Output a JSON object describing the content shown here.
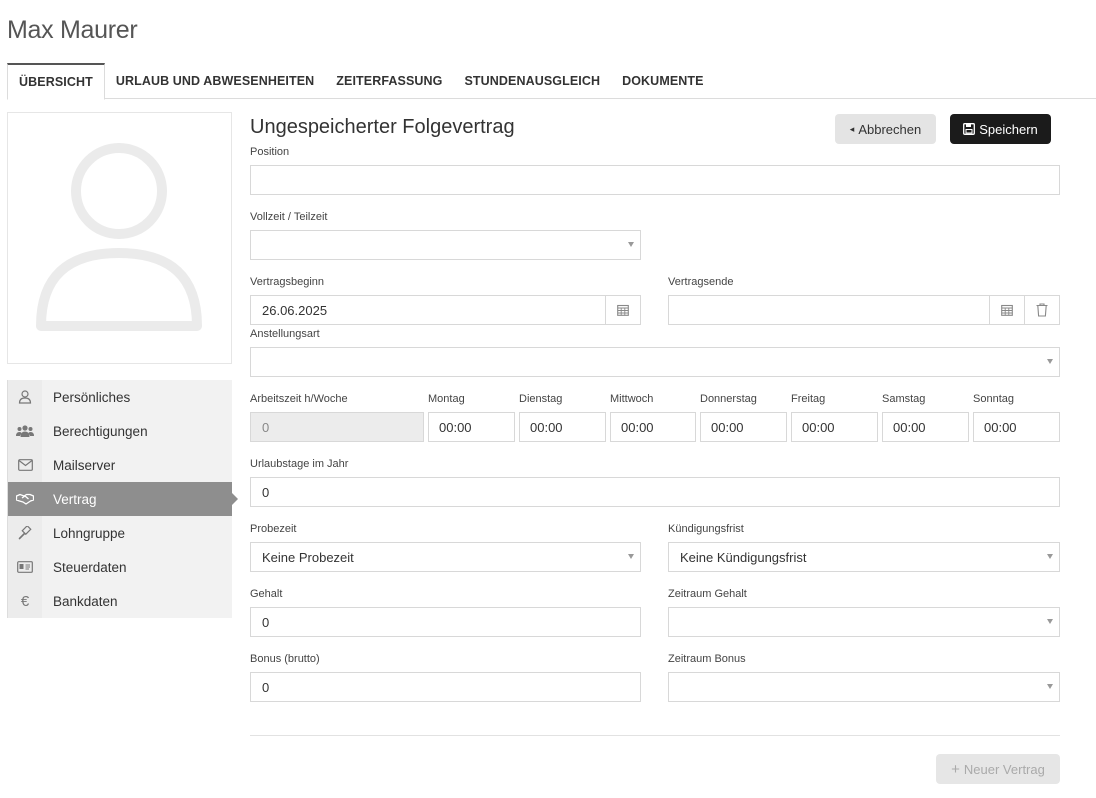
{
  "header": {
    "employee_name": "Max Maurer"
  },
  "tabs": [
    {
      "label": "ÜBERSICHT",
      "active": true
    },
    {
      "label": "URLAUB UND ABWESENHEITEN"
    },
    {
      "label": "ZEITERFASSUNG"
    },
    {
      "label": "STUNDENAUSGLEICH"
    },
    {
      "label": "DOKUMENTE"
    }
  ],
  "sidebar": {
    "items": [
      {
        "label": "Persönliches",
        "icon": "user-icon"
      },
      {
        "label": "Berechtigungen",
        "icon": "users-icon"
      },
      {
        "label": "Mailserver",
        "icon": "envelope-icon"
      },
      {
        "label": "Vertrag",
        "icon": "handshake-icon",
        "active": true
      },
      {
        "label": "Lohngruppe",
        "icon": "gavel-icon"
      },
      {
        "label": "Steuerdaten",
        "icon": "id-card-icon"
      },
      {
        "label": "Bankdaten",
        "icon": "euro-icon"
      }
    ]
  },
  "form": {
    "title": "Ungespeicherter Folgevertrag",
    "cancel_label": "Abbrechen",
    "save_label": "Speichern",
    "position": {
      "label": "Position",
      "value": ""
    },
    "vollzeit": {
      "label": "Vollzeit / Teilzeit",
      "value": ""
    },
    "vertragsbeginn": {
      "label": "Vertragsbeginn",
      "value": "26.06.2025"
    },
    "vertragsende": {
      "label": "Vertragsende",
      "value": ""
    },
    "anstellungsart": {
      "label": "Anstellungsart",
      "value": ""
    },
    "arbeitszeit": {
      "label": "Arbeitszeit h/Woche",
      "value": "0"
    },
    "days": [
      {
        "label": "Montag",
        "value": "00:00"
      },
      {
        "label": "Dienstag",
        "value": "00:00"
      },
      {
        "label": "Mittwoch",
        "value": "00:00"
      },
      {
        "label": "Donnerstag",
        "value": "00:00"
      },
      {
        "label": "Freitag",
        "value": "00:00"
      },
      {
        "label": "Samstag",
        "value": "00:00"
      },
      {
        "label": "Sonntag",
        "value": "00:00"
      }
    ],
    "urlaubstage": {
      "label": "Urlaubstage im Jahr",
      "value": "0"
    },
    "probezeit": {
      "label": "Probezeit",
      "value": "Keine Probezeit"
    },
    "kuendigungsfrist": {
      "label": "Kündigungsfrist",
      "value": "Keine Kündigungsfrist"
    },
    "gehalt": {
      "label": "Gehalt",
      "value": "0"
    },
    "zeitraum_gehalt": {
      "label": "Zeitraum Gehalt",
      "value": ""
    },
    "bonus": {
      "label": "Bonus (brutto)",
      "value": "0"
    },
    "zeitraum_bonus": {
      "label": "Zeitraum Bonus",
      "value": ""
    },
    "new_contract_label": "Neuer Vertrag"
  }
}
